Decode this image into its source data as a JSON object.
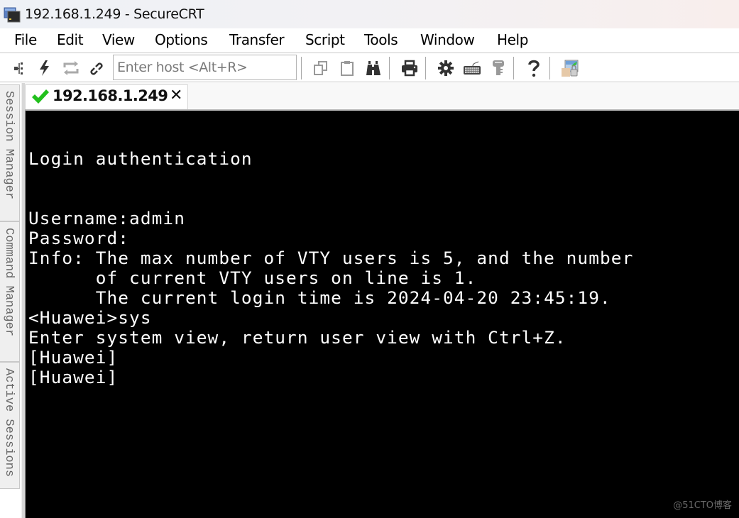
{
  "window": {
    "title": "192.168.1.249 - SecureCRT",
    "app_icon": "securecrt-app-icon"
  },
  "menubar": {
    "items": [
      "File",
      "Edit",
      "View",
      "Options",
      "Transfer",
      "Script",
      "Tools",
      "Window",
      "Help"
    ]
  },
  "toolbar": {
    "host_input_placeholder": "Enter host <Alt+R>",
    "host_input_value": "",
    "icons": [
      "connect-in-tab-icon",
      "quick-connect-icon",
      "reconnect-icon",
      "disconnect-icon",
      "copy-icon",
      "paste-icon",
      "find-icon",
      "print-icon",
      "session-options-icon",
      "keymap-icon",
      "public-key-icon",
      "help-icon",
      "secure-file-transfer-icon"
    ]
  },
  "tabs": [
    {
      "label": "192.168.1.249",
      "status": "connected",
      "status_color": "#22c01d",
      "close_label": "✕"
    }
  ],
  "side_panels": [
    "Session Manager",
    "Command Manager",
    "Active Sessions"
  ],
  "terminal": {
    "background": "#000000",
    "foreground": "#ffffff",
    "lines": [
      "Login authentication",
      "",
      "",
      "Username:admin",
      "Password:",
      "Info: The max number of VTY users is 5, and the number",
      "      of current VTY users on line is 1.",
      "      The current login time is 2024-04-20 23:45:19.",
      "<Huawei>sys",
      "Enter system view, return user view with Ctrl+Z.",
      "[Huawei]",
      "[Huawei]"
    ]
  },
  "watermark": "@51CTO博客"
}
